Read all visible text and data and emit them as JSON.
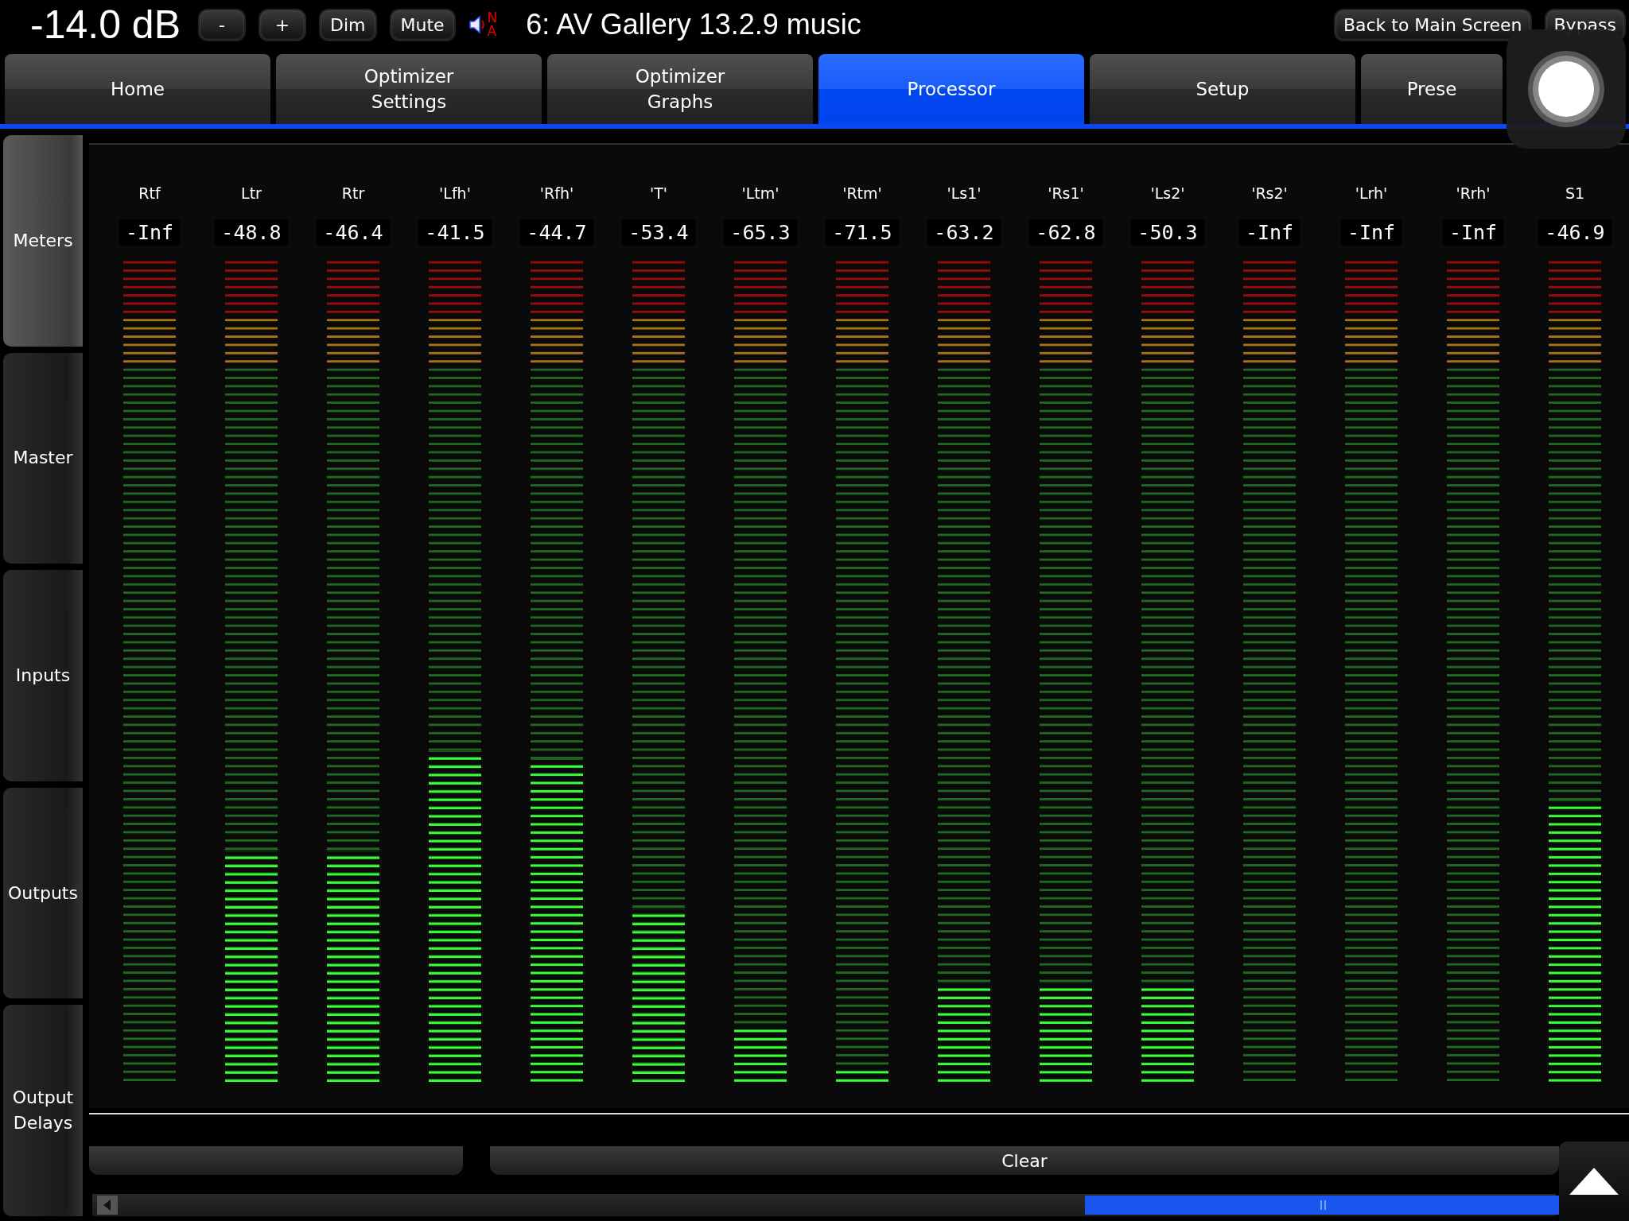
{
  "top_bar": {
    "volume": "-14.0 dB",
    "buttons": [
      "-",
      "+",
      "Dim",
      "Mute"
    ],
    "speaker_marks": [
      "N",
      "A"
    ],
    "title": "6: AV Gallery 13.2.9 music",
    "right_buttons": [
      "Back to Main Screen",
      "Bypass"
    ]
  },
  "tabs": [
    {
      "label": "Home",
      "selected": false
    },
    {
      "label": "Optimizer\nSettings",
      "selected": false
    },
    {
      "label": "Optimizer\nGraphs",
      "selected": false
    },
    {
      "label": "Processor",
      "selected": true
    },
    {
      "label": "Setup",
      "selected": false
    },
    {
      "label": "Prese",
      "selected": false
    }
  ],
  "sidebar": {
    "items": [
      {
        "label": "Meters",
        "selected": true
      },
      {
        "label": "Master",
        "selected": false
      },
      {
        "label": "Inputs",
        "selected": false
      },
      {
        "label": "Outputs",
        "selected": false
      },
      {
        "label": "Output\nDelays",
        "selected": false
      }
    ]
  },
  "meters": [
    {
      "name": "Rtf",
      "reading": "-Inf",
      "level": 0
    },
    {
      "name": "Ltr",
      "reading": "-48.8",
      "level": 0.28
    },
    {
      "name": "Rtr",
      "reading": "-46.4",
      "level": 0.28
    },
    {
      "name": "'Lfh'",
      "reading": "-41.5",
      "level": 0.4
    },
    {
      "name": "'Rfh'",
      "reading": "-44.7",
      "level": 0.39
    },
    {
      "name": "'T'",
      "reading": "-53.4",
      "level": 0.21
    },
    {
      "name": "'Ltm'",
      "reading": "-65.3",
      "level": 0.07
    },
    {
      "name": "'Rtm'",
      "reading": "-71.5",
      "level": 0.02
    },
    {
      "name": "'Ls1'",
      "reading": "-63.2",
      "level": 0.12
    },
    {
      "name": "'Rs1'",
      "reading": "-62.8",
      "level": 0.12
    },
    {
      "name": "'Ls2'",
      "reading": "-50.3",
      "level": 0.12
    },
    {
      "name": "'Rs2'",
      "reading": "-Inf",
      "level": 0
    },
    {
      "name": "'Lrh'",
      "reading": "-Inf",
      "level": 0
    },
    {
      "name": "'Rrh'",
      "reading": "-Inf",
      "level": 0
    },
    {
      "name": "S1",
      "reading": "-46.9",
      "level": 0.34
    }
  ],
  "bottom": {
    "clear_button": "Clear"
  }
}
